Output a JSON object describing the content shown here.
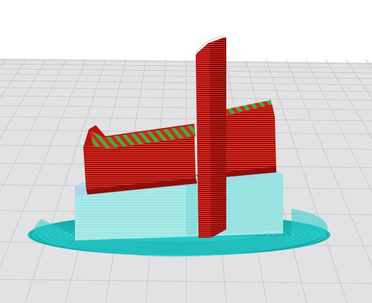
{
  "viewport": {
    "background_color": "#ffffff",
    "build_plate_color": "#e4e4e6",
    "grid_line_color": "#c9c9cc"
  },
  "model": {
    "shell_color": "#e8261e",
    "shell_dark_color": "#b81410",
    "infill_color": "#2aa12a",
    "support_color": "#9fe6e4",
    "support_dark_color": "#6fcfd0",
    "skirt_color": "#27c9c7",
    "layer_line_color": "#5a0c08"
  }
}
